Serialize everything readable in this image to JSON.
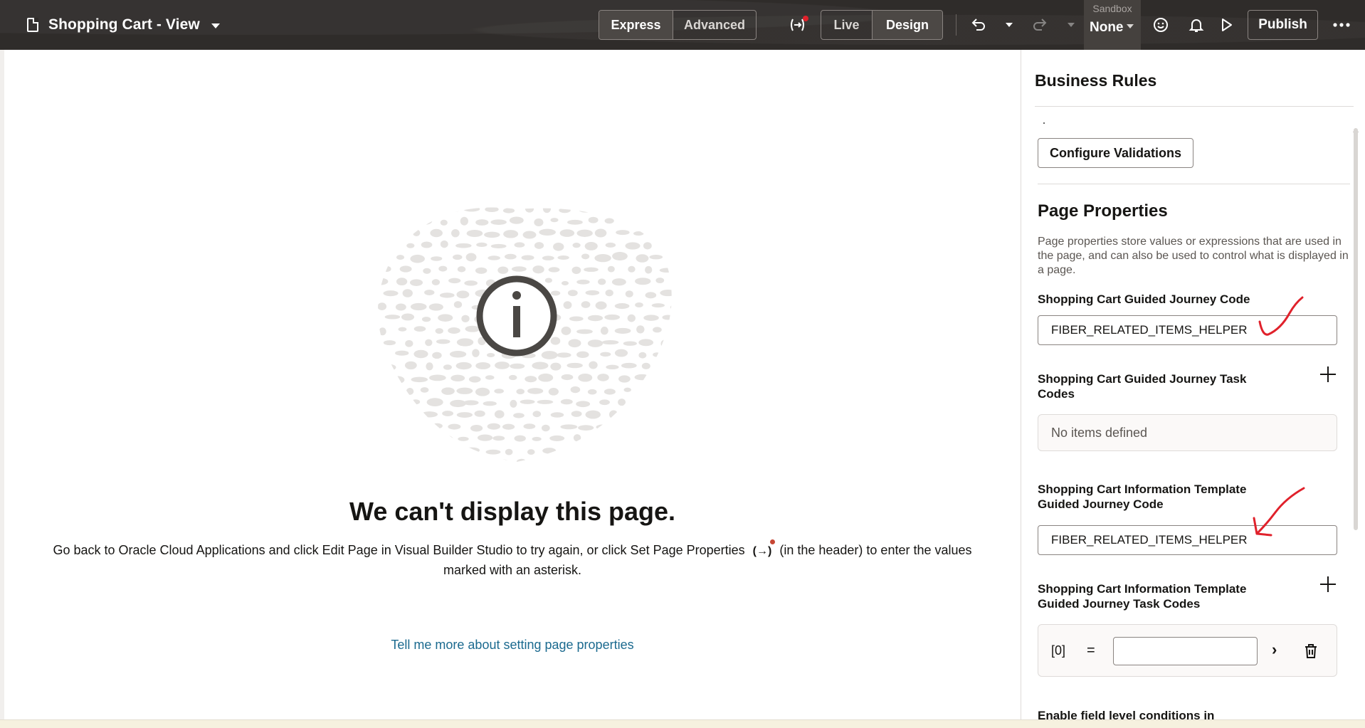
{
  "header": {
    "title": "Shopping Cart - View",
    "mode_tabs": [
      {
        "label": "Express",
        "active": true
      },
      {
        "label": "Advanced",
        "active": false
      }
    ],
    "view_tabs": [
      {
        "label": "Live",
        "active": false
      },
      {
        "label": "Design",
        "active": true
      }
    ],
    "sandbox_label": "Sandbox",
    "sandbox_value": "None",
    "publish_label": "Publish",
    "icons": [
      "page-icon",
      "page-properties-icon",
      "undo-icon",
      "redo-icon",
      "feedback-smiley-icon",
      "notifications-bell-icon",
      "run-play-icon",
      "more-icon"
    ]
  },
  "canvas": {
    "title": "We can't display this page.",
    "body_part1": "Go back to Oracle Cloud Applications and click Edit Page in Visual Builder Studio to try again, or click Set Page Properties",
    "body_icon": "(→)",
    "body_part2": "(in the header) to enter the values marked with an asterisk.",
    "link": "Tell me more about setting page properties"
  },
  "panel": {
    "title": "Business Rules",
    "configure_button": "Configure Validations",
    "section_title": "Page Properties",
    "section_desc": "Page properties store values or expressions that are used in the page, and can also be used to control what is displayed in a page.",
    "fields": {
      "journey_code_label": "Shopping Cart Guided Journey Code",
      "journey_code_value": "FIBER_RELATED_ITEMS_HELPER",
      "task_codes_label": "Shopping Cart Guided Journey Task Codes",
      "task_codes_empty": "No items defined",
      "info_code_label": "Shopping Cart Information Template Guided Journey Code",
      "info_code_value": "FIBER_RELATED_ITEMS_HELPER",
      "info_task_codes_label": "Shopping Cart Information Template Guided Journey Task Codes",
      "array_index": "[0]",
      "array_eq": "=",
      "array_value": "",
      "cut_label": "Enable field level conditions in"
    }
  },
  "colors": {
    "header_bg": "#2f2c2a",
    "link": "#1b6a8f",
    "notification_dot": "#c74634",
    "annotation": "#e0212b"
  }
}
